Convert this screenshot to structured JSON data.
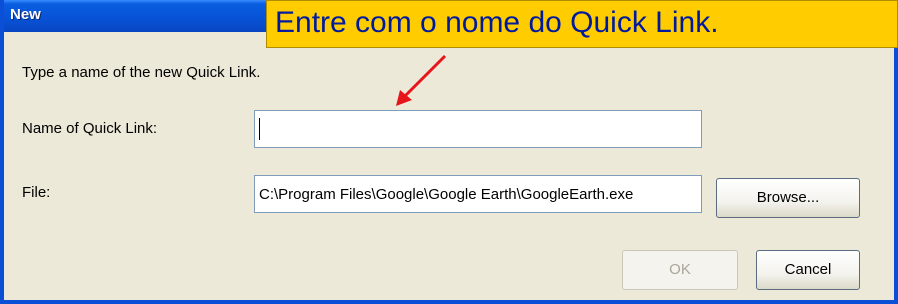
{
  "window": {
    "title": "New"
  },
  "annotation": {
    "text": "Entre com o nome do Quick Link."
  },
  "dialog": {
    "instruction": "Type a name of the new Quick Link.",
    "name_label": "Name of Quick Link:",
    "name_value": "",
    "file_label": "File:",
    "file_value": "C:\\Program Files\\Google\\Google Earth\\GoogleEarth.exe",
    "browse_label": "Browse...",
    "ok_label": "OK",
    "cancel_label": "Cancel"
  },
  "colors": {
    "titlebar": "#0753d8",
    "annotation_bg": "#ffcc00",
    "annotation_text": "#001a9e",
    "arrow": "#e8141b"
  }
}
